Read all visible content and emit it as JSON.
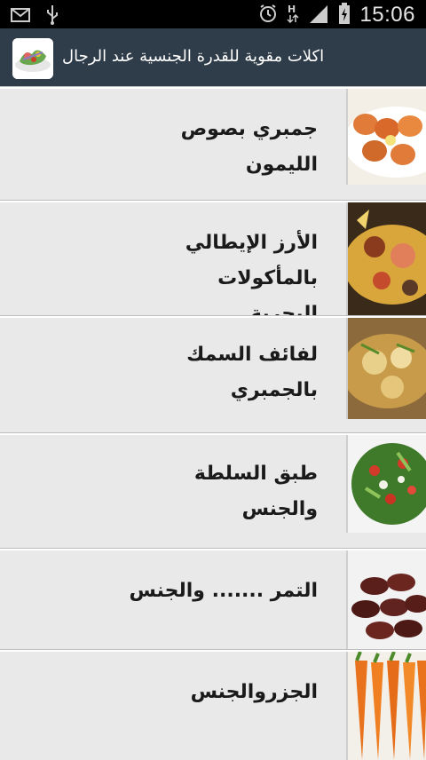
{
  "status_bar": {
    "time": "15:06"
  },
  "app": {
    "title": "اكلات مقوية للقدرة الجنسية عند الرجال",
    "icon": "salad-plate-icon"
  },
  "items": [
    {
      "title": "جمبري بصوص الليمون",
      "line1": "جمبري بصوص",
      "line2": "الليمون",
      "image": "shrimp-lemon-image"
    },
    {
      "title": "الأرز الإيطالي بالمأكولات البحرية",
      "line1": "الأرز الإيطالي بالمأكولات",
      "line2": "البحرية",
      "image": "seafood-risotto-image"
    },
    {
      "title": "لفائف السمك بالجمبري",
      "line1": "لفائف السمك",
      "line2": "بالجمبري",
      "image": "fish-rolls-image"
    },
    {
      "title": "طبق السلطة والجنس",
      "line1": "طبق السلطة",
      "line2": "والجنس",
      "image": "salad-bowl-image"
    },
    {
      "title": "التمر ....... والجنس",
      "line1": "التمر ....... والجنس",
      "line2": "",
      "image": "dates-image"
    },
    {
      "title": "الجزروالجنس",
      "line1": "الجزروالجنس",
      "line2": "",
      "image": "carrots-image"
    }
  ]
}
